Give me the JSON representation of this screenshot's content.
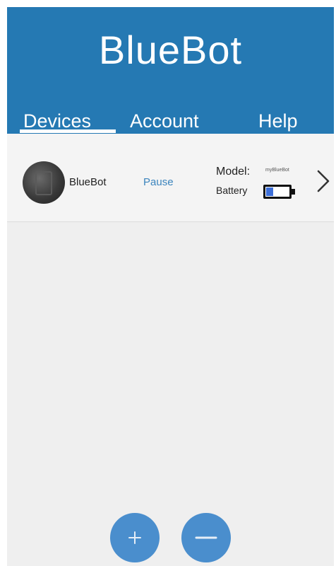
{
  "app": {
    "title": "BlueBot"
  },
  "tabs": [
    {
      "label": "Devices",
      "active": true
    },
    {
      "label": "Account",
      "active": false
    },
    {
      "label": "Help",
      "active": false
    }
  ],
  "devices": [
    {
      "name": "BlueBot",
      "action_label": "Pause",
      "model_label": "Model:",
      "model_value": "myBlueBot",
      "battery_label": "Battery",
      "battery_level": 0.3
    }
  ],
  "actions": {
    "add_icon": "plus-icon",
    "remove_icon": "minus-icon"
  },
  "colors": {
    "header": "#2579b3",
    "accent": "#4a8ecd",
    "link": "#3b84bd",
    "background": "#efefef",
    "battery_fill": "#3d6fd8"
  }
}
